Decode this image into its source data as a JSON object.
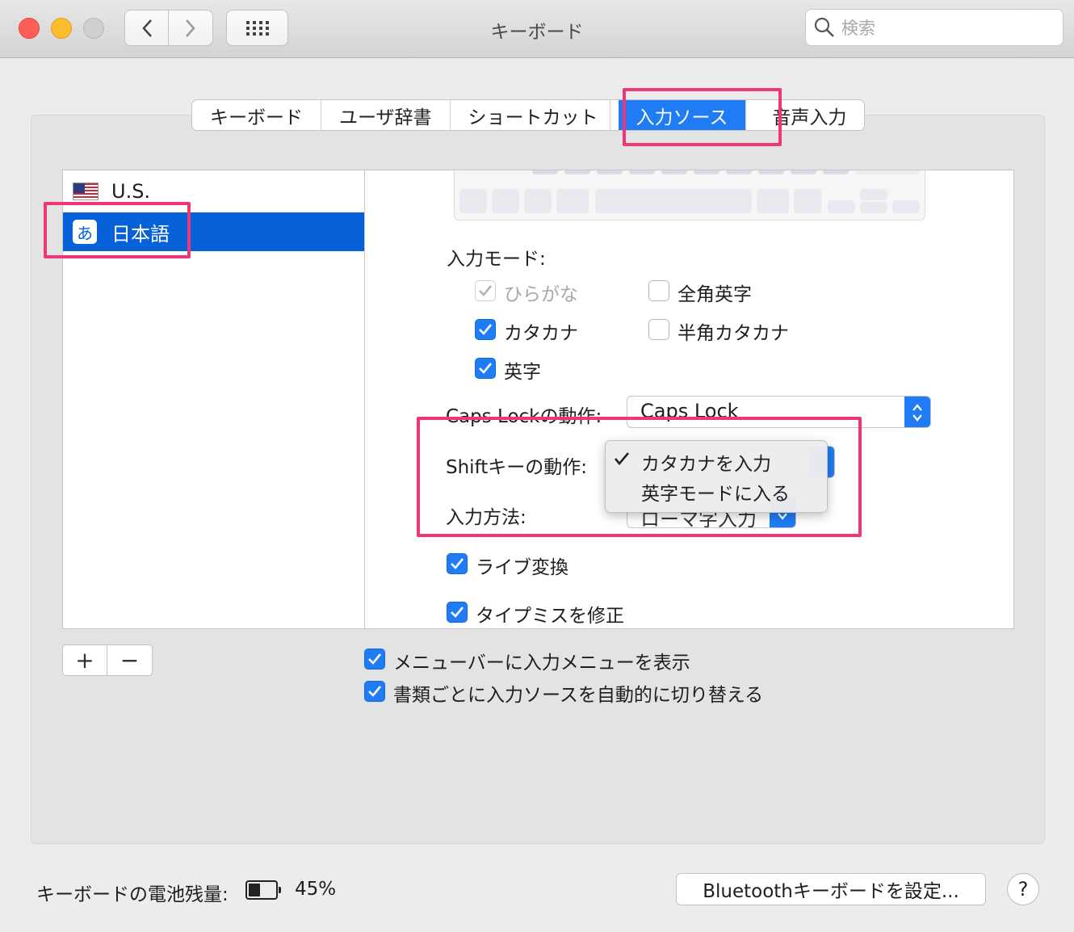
{
  "window": {
    "title": "キーボード"
  },
  "search": {
    "placeholder": "検索"
  },
  "tabs": [
    {
      "label": "キーボード"
    },
    {
      "label": "ユーザ辞書"
    },
    {
      "label": "ショートカット"
    },
    {
      "label": "入力ソース",
      "active": true
    },
    {
      "label": "音声入力"
    }
  ],
  "sources": [
    {
      "label": "U.S.",
      "icon": "us-flag-icon"
    },
    {
      "label": "日本語",
      "icon": "hiragana-a-icon",
      "badge": "あ",
      "selected": true
    }
  ],
  "input_mode": {
    "heading": "入力モード:",
    "options": [
      {
        "label": "ひらがな",
        "checked": true,
        "disabled": true
      },
      {
        "label": "全角英字",
        "checked": false
      },
      {
        "label": "カタカナ",
        "checked": true
      },
      {
        "label": "半角カタカナ",
        "checked": false
      },
      {
        "label": "英字",
        "checked": true
      }
    ]
  },
  "caps_lock": {
    "label": "Caps Lockの動作:",
    "value": "Caps Lock"
  },
  "shift_key": {
    "label": "Shiftキーの動作:",
    "menu": [
      {
        "label": "カタカナを入力",
        "checked": true
      },
      {
        "label": "英字モードに入る",
        "checked": false
      }
    ]
  },
  "input_method": {
    "label": "入力方法:",
    "value": "ローマ字入力"
  },
  "live_conversion": {
    "label": "ライブ変換",
    "checked": true
  },
  "typo_fix": {
    "label": "タイプミスを修正",
    "checked": true
  },
  "list_controls": {
    "add": "+",
    "remove": "−"
  },
  "global_options": [
    {
      "label": "メニューバーに入力メニューを表示",
      "checked": true
    },
    {
      "label": "書類ごとに入力ソースを自動的に切り替える",
      "checked": true
    }
  ],
  "footer": {
    "battery_label": "キーボードの電池残量:",
    "battery_level": 0.45,
    "battery_percent": "45%",
    "bluetooth_button": "Bluetoothキーボードを設定...",
    "help": "?"
  },
  "colors": {
    "accent": "#1f7cf5",
    "selection": "#0762da",
    "highlight": "#f0367a"
  }
}
